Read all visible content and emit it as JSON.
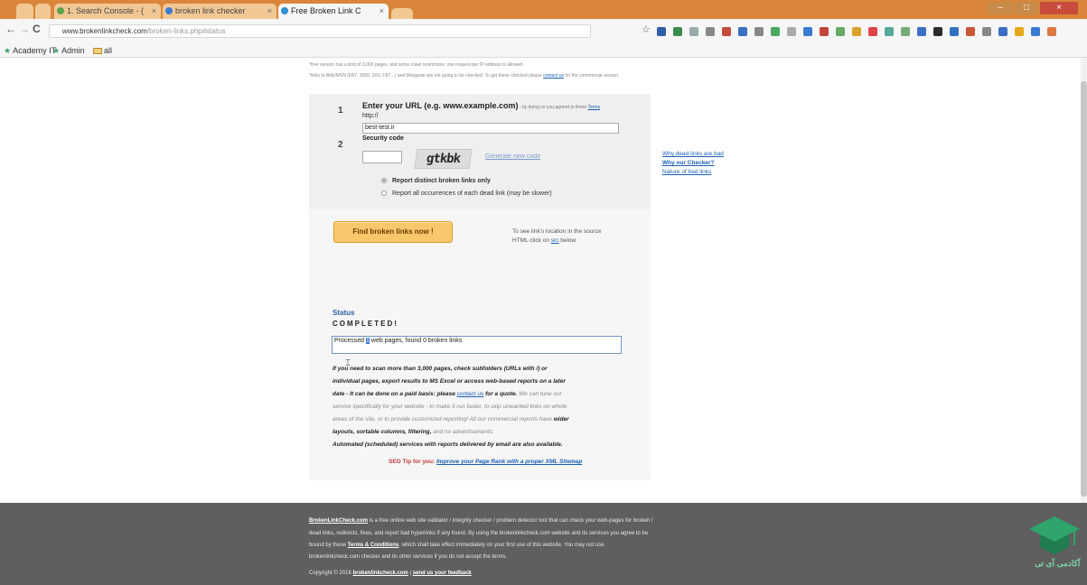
{
  "browser": {
    "tabs": [
      {
        "label": "1. Search Console - ("
      },
      {
        "label": "broken link checker"
      },
      {
        "label": "Free Broken Link C"
      }
    ],
    "tab_close": "×",
    "window_controls": {
      "minimize": "–",
      "maximize": "□",
      "close": "×"
    },
    "nav": {
      "back": "←",
      "forward": "→",
      "reload": "C"
    },
    "address": {
      "host": "www.brokenlinkcheck.com",
      "path": "/broken-links.php#status"
    },
    "bookmark_star": "☆",
    "bookmarks": [
      {
        "label": "Academy IT"
      },
      {
        "label": "Admin"
      },
      {
        "label": "all"
      }
    ],
    "extension_colors": [
      "#2f5da8",
      "#3b8a4e",
      "#9aa",
      "#888",
      "#c24a3a",
      "#3a6fc4",
      "#888",
      "#4aa860",
      "#aaa",
      "#3a7ad2",
      "#c2463a",
      "#6a6",
      "#d8a22a",
      "#d44",
      "#5a9",
      "#7a7",
      "#3a6fc4",
      "#2c2c2c",
      "#2f72c4",
      "#c53",
      "#888",
      "#3a6fc4",
      "#e8a81b",
      "#3a7ad2",
      "#d74"
    ]
  },
  "page": {
    "notes": {
      "line1": "*free version has a limit of 3,000 pages, and some crawl restrictions: one request per IP address is allowed",
      "line2": "*links to Bitly/MSN (FB7, 3000, 3X0, FB7...) and Morgante are not going to be checked. To get these checked please",
      "line2_link": "contact us",
      "line2_tail": "for the commercial version."
    },
    "form": {
      "step1": "1",
      "url_label": "Enter your URL (e.g. www.example.com)",
      "url_terms_note": " - by doing so you agreed to these",
      "url_terms_link": "Terms",
      "protocol": "http://",
      "url_value": "best-test.ir",
      "step2": "2",
      "security_label": "Security code",
      "captcha_text": "gtkbk",
      "generate_new_code": "Generate new code",
      "radio_distinct": "Report distinct broken links only",
      "radio_all": "Report all occurrences of each dead link (may be slower)",
      "find_button": "Find broken links now !",
      "hint_line1": "To see link's location in the source",
      "hint_line2_pre": "HTML click on",
      "hint_line2_link": "src",
      "hint_line2_post": "below"
    },
    "status": {
      "label": "Status",
      "value": "COMPLETED!",
      "result_pre": "Processed ",
      "result_sel": "1",
      "result_post": " web pages, found 0 broken links"
    },
    "paragraph": [
      {
        "b": "If you need to scan more than 3,000 pages, check subfolders (URLs with /) or"
      },
      {
        "b": "individual pages, export results to MS Excel or access web-based reports on a later"
      },
      {
        "b": "date - It can be done on a paid basis: please ",
        "u": "contact us",
        "b2": " for a quote.",
        "lt": " We can tune our"
      },
      {
        "lt": "service specifically for your website - to make it run faster, to skip unwanted links on whole"
      },
      {
        "lt": "areas of the site, or to provide customized reporting! All our commercial reports have ",
        "b": "wider"
      },
      {
        "b": "layouts, sortable columns, filtering,",
        "lt": " and no advertisements."
      },
      {
        "b": "Automated (scheduled) services with reports delivered by email are also available."
      }
    ],
    "seo_tip": {
      "label": "SEO Tip for you:",
      "link": "Improve your Page Rank with a proper XML Sitemap"
    },
    "side_links": [
      "Why dead links are bad",
      "Why our Checker?",
      "Nature of bad links"
    ],
    "footer": {
      "line1_link": "BrokenLinkCheck.com",
      "line1": " is a free online web site validator / integrity checker / problem detector tool that can check your web-pages for broken /",
      "line2": "dead links, redirects, fixes, and report bad hyperlinks if any found. By using the brokenlinkcheck.com website and its services you agree to be",
      "line3_pre": "bound by these ",
      "line3_link": "Terms & Conditions",
      "line3": ", which shall take effect immediately on your first use of this website. You may not use",
      "line4": "brokenlinkcheck.com checker and its other services if you do not accept the terms.",
      "copyright": "Copyright © 2016 ",
      "copyright_link": "brokenlinkcheck.com",
      "sep": " | ",
      "feedback_link": "send us your feedback"
    },
    "watermark_text": "آکادمی آی تی"
  }
}
